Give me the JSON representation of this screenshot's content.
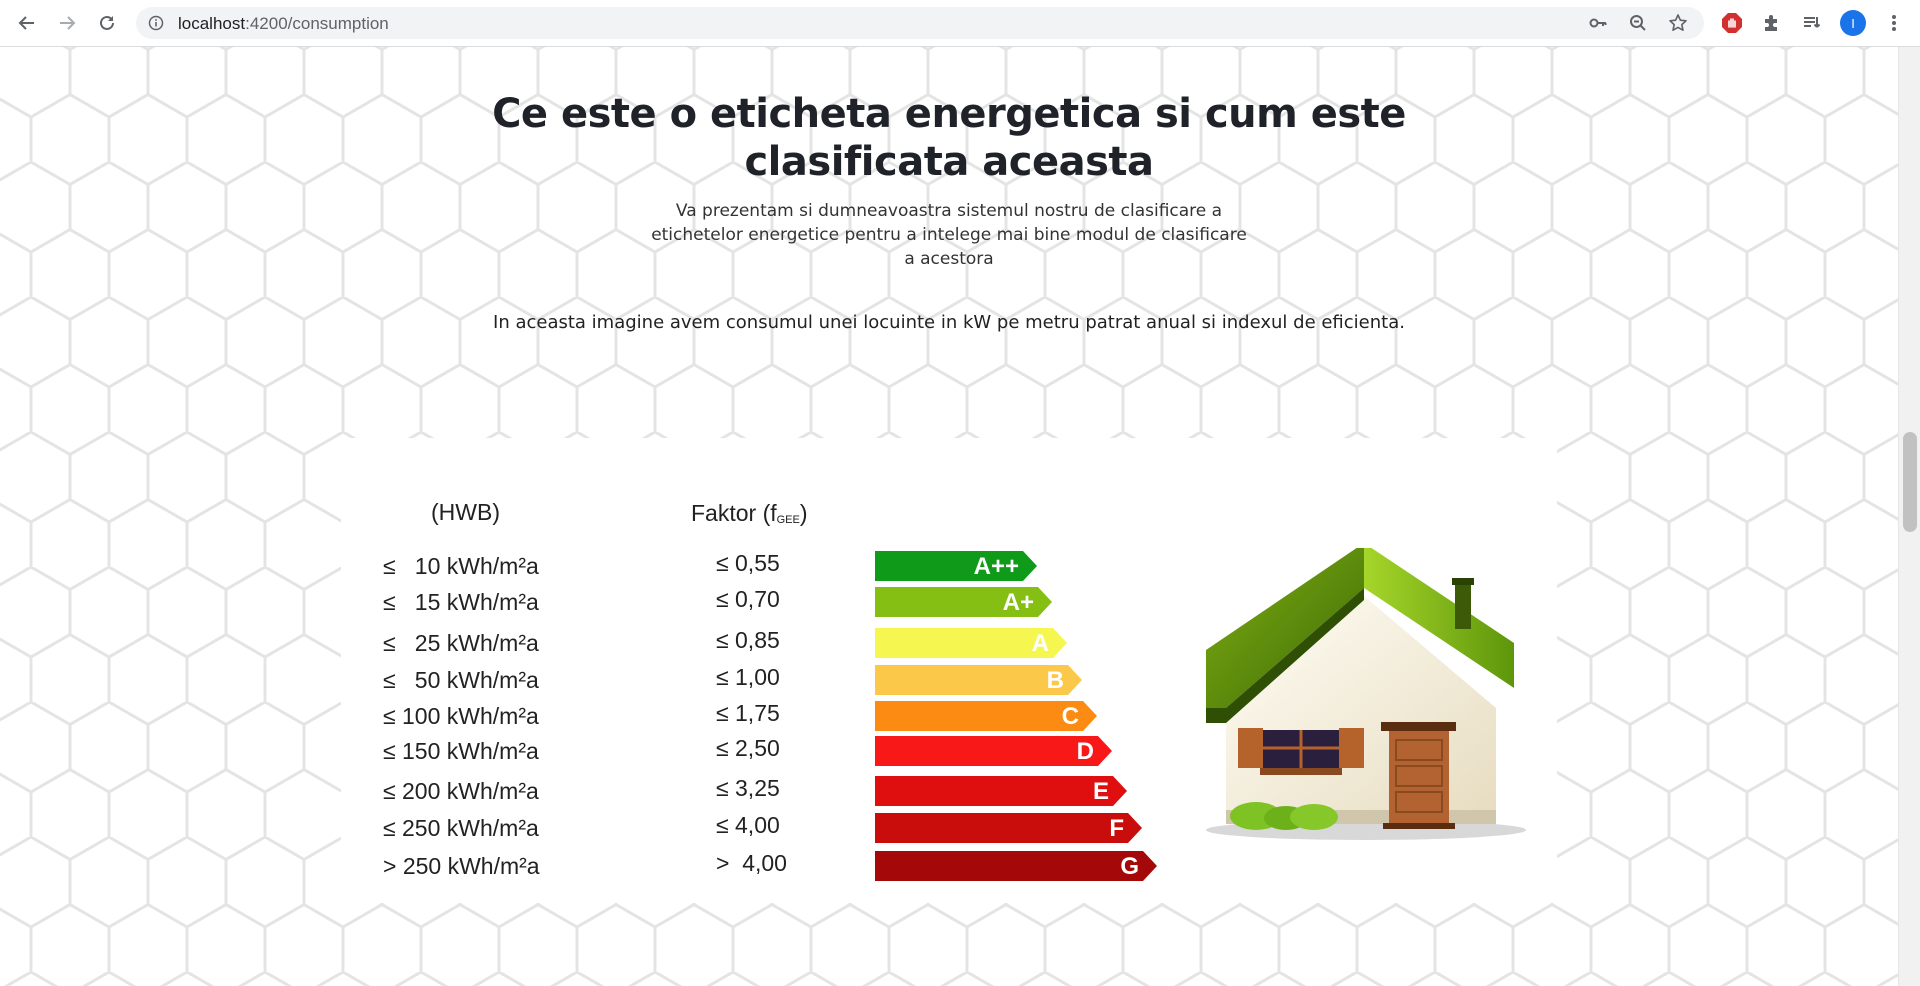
{
  "browser": {
    "url_host": "localhost",
    "url_path": ":4200/consumption",
    "profile_initial": "I"
  },
  "page": {
    "title": "Ce este o eticheta energetica si cum este clasificata aceasta",
    "subtitle": "Va prezentam si dumneavoastra sistemul nostru de clasificare a etichetelor energetice pentru a intelege mai bine modul de clasificare a acestora",
    "description": "In aceasta imagine avem consumul unei locuinte in kW pe metru patrat anual si indexul de eficienta."
  },
  "energy_label": {
    "hwb_header": "(HWB)",
    "factor_header": "Faktor (f",
    "factor_header_sub": "GEE",
    "factor_header_close": ")",
    "rows": [
      {
        "hwb": "≤   10 kWh/m²a",
        "factor": "≤ 0,55",
        "class": "A++",
        "color": "#0f9a1a"
      },
      {
        "hwb": "≤   15 kWh/m²a",
        "factor": "≤ 0,70",
        "class": "A+",
        "color": "#86bf14"
      },
      {
        "hwb": "≤   25 kWh/m²a",
        "factor": "≤ 0,85",
        "class": "A",
        "color": "#f6f650"
      },
      {
        "hwb": "≤   50 kWh/m²a",
        "factor": "≤ 1,00",
        "class": "B",
        "color": "#fcc84a"
      },
      {
        "hwb": "≤ 100 kWh/m²a",
        "factor": "≤ 1,75",
        "class": "C",
        "color": "#fb8b12"
      },
      {
        "hwb": "≤ 150 kWh/m²a",
        "factor": "≤ 2,50",
        "class": "D",
        "color": "#f81818"
      },
      {
        "hwb": "≤ 200 kWh/m²a",
        "factor": "≤ 3,25",
        "class": "E",
        "color": "#e00f0f"
      },
      {
        "hwb": "≤ 250 kWh/m²a",
        "factor": "≤ 4,00",
        "class": "F",
        "color": "#c90c0c"
      },
      {
        "hwb": "> 250 kWh/m²a",
        "factor": ">  4,00",
        "class": "G",
        "color": "#a50808"
      }
    ]
  }
}
